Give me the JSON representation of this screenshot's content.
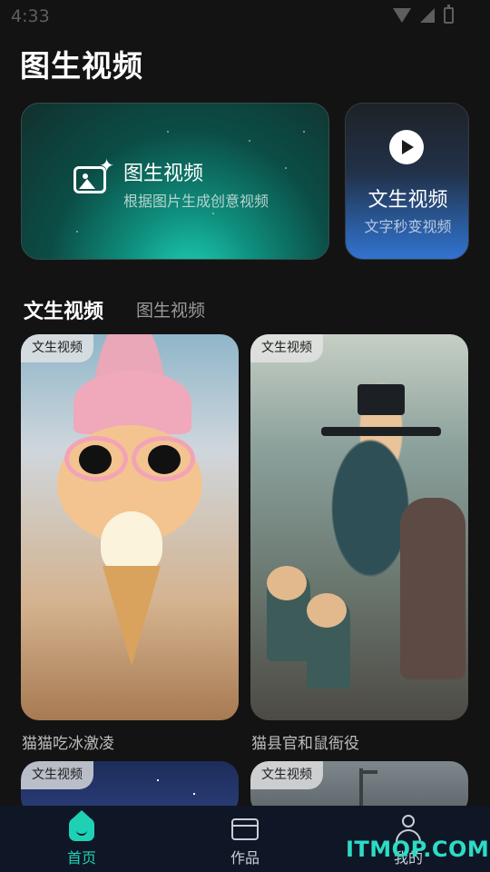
{
  "status_bar": {
    "time": "4:33"
  },
  "page": {
    "title": "图生视频"
  },
  "feature_cards": {
    "image_to_video": {
      "title": "图生视频",
      "subtitle": "根据图片生成创意视频"
    },
    "text_to_video": {
      "title": "文生视频",
      "subtitle": "文字秒变视频"
    }
  },
  "tabs": [
    {
      "label": "文生视频",
      "active": true
    },
    {
      "label": "图生视频",
      "active": false
    }
  ],
  "gallery": [
    {
      "badge": "文生视频",
      "caption": "猫猫吃冰激凌"
    },
    {
      "badge": "文生视频",
      "caption": "猫县官和鼠衙役"
    },
    {
      "badge": "文生视频",
      "caption": ""
    },
    {
      "badge": "文生视频",
      "caption": ""
    }
  ],
  "bottom_nav": [
    {
      "label": "首页",
      "icon": "home-icon",
      "active": true
    },
    {
      "label": "作品",
      "icon": "folder-icon",
      "active": false
    },
    {
      "label": "我的",
      "icon": "user-icon",
      "active": false
    }
  ],
  "watermark": "ITMOP.COM",
  "colors": {
    "accent": "#1fd1b4",
    "background": "#131313",
    "nav_background": "#0f1726"
  }
}
